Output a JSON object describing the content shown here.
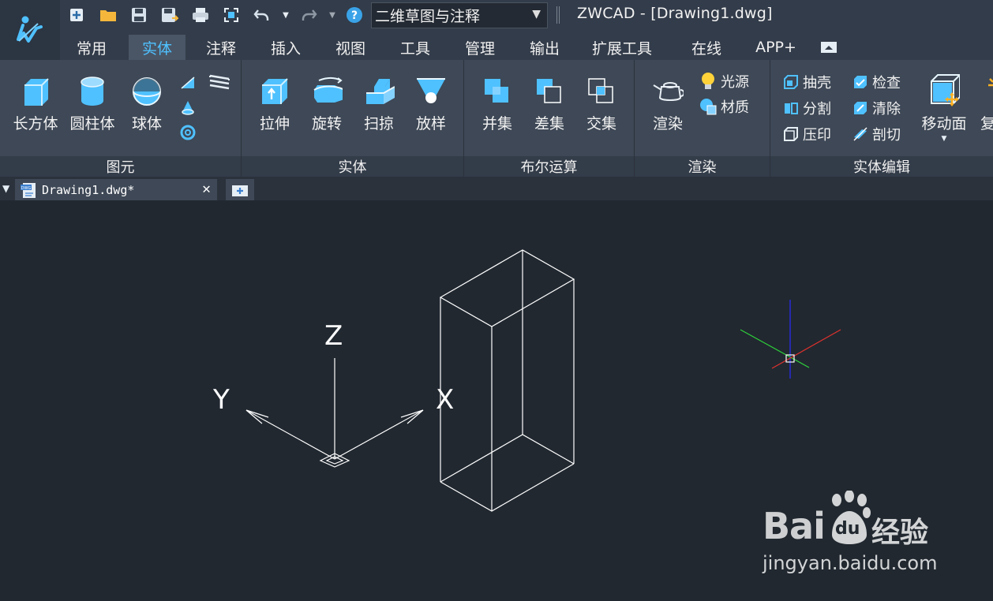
{
  "app": {
    "logo_icon": "zwcad-logo-icon"
  },
  "quick_access": {
    "icons": [
      "new-icon",
      "open-folder-icon",
      "save-icon",
      "save-as-icon",
      "print-icon",
      "zoom-extents-icon",
      "undo-icon",
      "undo-dropdown-icon",
      "redo-icon",
      "redo-dropdown-icon",
      "help-icon"
    ],
    "workspace": "二维草图与注释"
  },
  "window": {
    "title": "ZWCAD - [Drawing1.dwg]"
  },
  "menu": {
    "tabs": [
      "常用",
      "实体",
      "注释",
      "插入",
      "视图",
      "工具",
      "管理",
      "输出",
      "扩展工具",
      "在线",
      "APP+"
    ],
    "active": "实体"
  },
  "ribbon": {
    "primitives": {
      "label": "图元",
      "box": "长方体",
      "cylinder": "圆柱体",
      "sphere": "球体"
    },
    "solids": {
      "label": "实体",
      "extrude": "拉伸",
      "revolve": "旋转",
      "sweep": "扫掠",
      "loft": "放样"
    },
    "boolean": {
      "label": "布尔运算",
      "union": "并集",
      "subtract": "差集",
      "intersect": "交集"
    },
    "render": {
      "label": "渲染",
      "render": "渲染",
      "lights": "光源",
      "materials": "材质"
    },
    "solid_edit": {
      "label": "实体编辑",
      "shell": "抽壳",
      "separate": "分割",
      "imprint": "压印",
      "check": "检查",
      "clean": "清除",
      "slice": "剖切",
      "move_face": "移动面",
      "copy_partial": "复"
    }
  },
  "doc_tabs": {
    "active": "Drawing1.dwg*"
  },
  "canvas": {
    "ucs_labels": {
      "x": "X",
      "y": "Y",
      "z": "Z"
    },
    "background": "#212830",
    "line_color": "#ffffff",
    "axis_colors": {
      "x": "#e0322d",
      "y": "#2ed13a",
      "z": "#2b2bff"
    }
  },
  "watermark": {
    "brand": "Bai",
    "paw": "du",
    "cn": "经验",
    "url": "jingyan.baidu.com"
  },
  "colors": {
    "accent": "#4fc1ff",
    "ribbon": "#3e4856",
    "titlebar": "#333c4a"
  }
}
